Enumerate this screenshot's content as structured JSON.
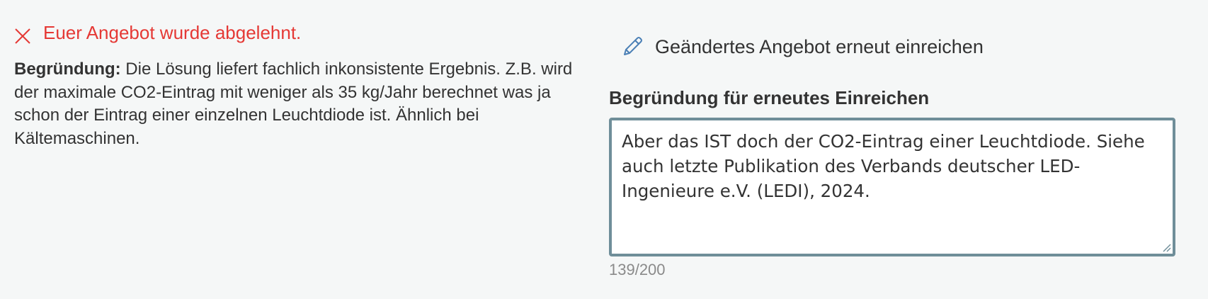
{
  "rejection": {
    "status_icon": "close-icon",
    "status_text": "Euer Angebot wurde abgelehnt.",
    "status_color": "#e53935",
    "reason_label": "Begründung:",
    "reason_text": " Die Lösung liefert fachlich inkonsistente Ergebnis. Z.B. wird der maximale CO2-Eintrag mit weniger als 35 kg/Jahr berechnet was ja schon der Eintrag einer einzelnen Leuchtdiode ist. Ähnlich bei Kältemaschinen."
  },
  "resubmit": {
    "icon": "pencil-icon",
    "label": "Geändertes Angebot erneut einreichen",
    "field_label": "Begründung für erneutes Einreichen",
    "field_value": "Aber das IST doch der CO2-Eintrag einer Leuchtdiode. Siehe auch letzte Publikation des Verbands deutscher LED-Ingenieure e.V. (LEDI), 2024.",
    "counter": "139/200",
    "border_color": "#6f8e99"
  }
}
